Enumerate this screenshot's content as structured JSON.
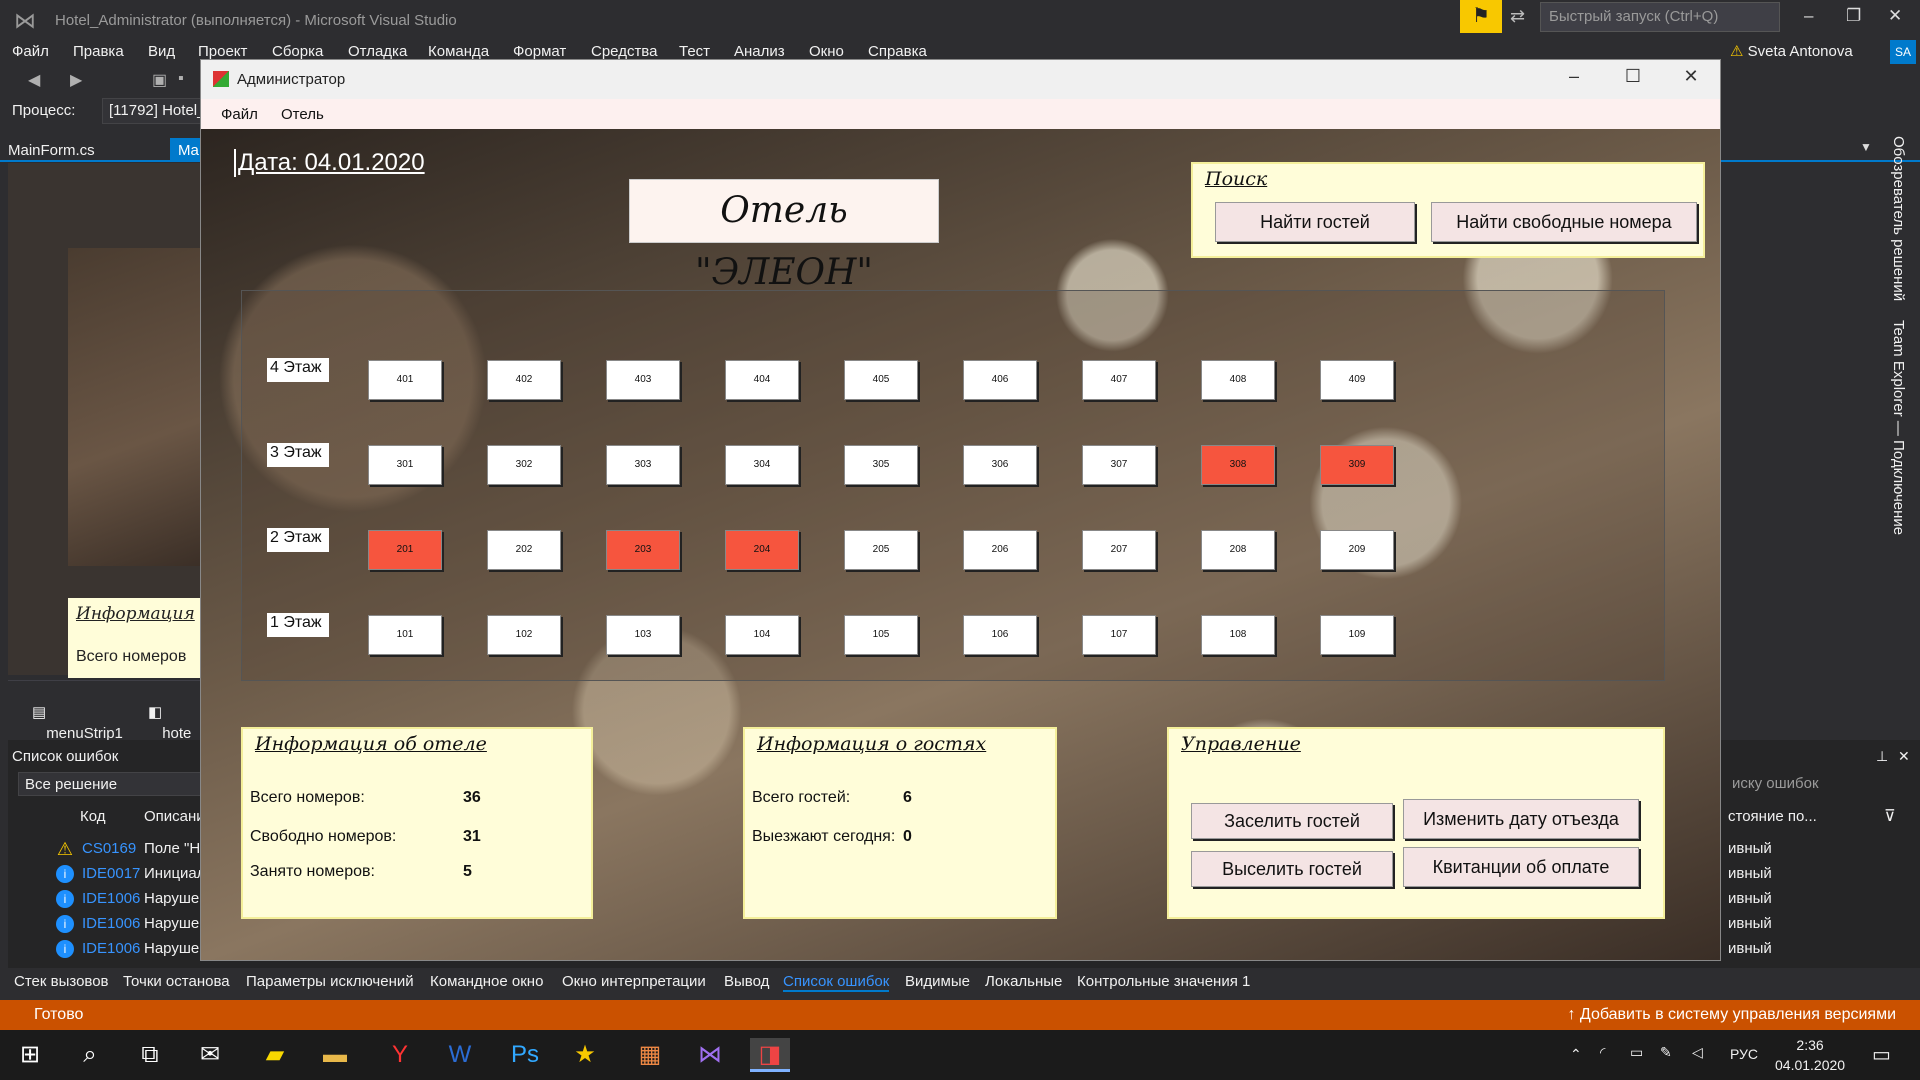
{
  "vs": {
    "title": "Hotel_Administrator (выполняется) - Microsoft Visual Studio",
    "quick_launch": "Быстрый запуск (Ctrl+Q)",
    "menu": [
      "Файл",
      "Правка",
      "Вид",
      "Проект",
      "Сборка",
      "Отладка",
      "Команда",
      "Формат",
      "Средства",
      "Тест",
      "Анализ",
      "Окно",
      "Справка"
    ],
    "user": "Sveta Antonova",
    "user_initials": "SA",
    "process_label": "Процесс:",
    "process_value": "[11792] Hotel_",
    "tab_file": "MainForm.cs",
    "tab_file2": "Ma",
    "designer_info_title": "Информация",
    "designer_info_line": "Всего номеров",
    "tray_items": [
      "menuStrip1",
      "hote"
    ],
    "errors_title": "Список ошибок",
    "errors_scope": "Все решение",
    "errors_col_code": "Код",
    "errors_col_desc": "Описани",
    "errors_search": "иску ошибок",
    "errors_state_col": "стояние по...",
    "errors": [
      {
        "type": "warn",
        "code": "CS0169",
        "desc": "Поле \"Но",
        "state": "ивный"
      },
      {
        "type": "info",
        "code": "IDE0017",
        "desc": "Инициал",
        "state": "ивный"
      },
      {
        "type": "info",
        "code": "IDE1006",
        "desc": "Нарушен",
        "state": "ивный"
      },
      {
        "type": "info",
        "code": "IDE1006",
        "desc": "Нарушен",
        "state": "ивный"
      },
      {
        "type": "info",
        "code": "IDE1006",
        "desc": "Нарушен",
        "state": "ивный"
      }
    ],
    "bottom_tabs": [
      "Стек вызовов",
      "Точки останова",
      "Параметры исключений",
      "Командное окно",
      "Окно интерпретации",
      "Вывод",
      "Список ошибок",
      "Видимые",
      "Локальные",
      "Контрольные значения 1"
    ],
    "bottom_tab_selected": "Список ошибок",
    "status_left": "Готово",
    "status_right": "Добавить в систему управления версиями",
    "side_panels": [
      "Обозреватель решений",
      "Team Explorer — Подключение"
    ]
  },
  "taskbar": {
    "lang": "РУС",
    "time": "2:36",
    "date": "04.01.2020"
  },
  "form": {
    "title": "Администратор",
    "menu": [
      "Файл",
      "Отель"
    ],
    "date_label": "Дата: 04.01.2020",
    "hotel_name": "Отель \"ЭЛЕОН\"",
    "search": {
      "title": "Поиск",
      "find_guests": "Найти гостей",
      "find_rooms": "Найти свободные номера"
    },
    "floors": [
      {
        "label": "4 Этаж",
        "rooms": [
          {
            "n": "401",
            "busy": false
          },
          {
            "n": "402",
            "busy": false
          },
          {
            "n": "403",
            "busy": false
          },
          {
            "n": "404",
            "busy": false
          },
          {
            "n": "405",
            "busy": false
          },
          {
            "n": "406",
            "busy": false
          },
          {
            "n": "407",
            "busy": false
          },
          {
            "n": "408",
            "busy": false
          },
          {
            "n": "409",
            "busy": false
          }
        ]
      },
      {
        "label": "3 Этаж",
        "rooms": [
          {
            "n": "301",
            "busy": false
          },
          {
            "n": "302",
            "busy": false
          },
          {
            "n": "303",
            "busy": false
          },
          {
            "n": "304",
            "busy": false
          },
          {
            "n": "305",
            "busy": false
          },
          {
            "n": "306",
            "busy": false
          },
          {
            "n": "307",
            "busy": false
          },
          {
            "n": "308",
            "busy": true
          },
          {
            "n": "309",
            "busy": true
          }
        ]
      },
      {
        "label": "2 Этаж",
        "rooms": [
          {
            "n": "201",
            "busy": true
          },
          {
            "n": "202",
            "busy": false
          },
          {
            "n": "203",
            "busy": true
          },
          {
            "n": "204",
            "busy": true
          },
          {
            "n": "205",
            "busy": false
          },
          {
            "n": "206",
            "busy": false
          },
          {
            "n": "207",
            "busy": false
          },
          {
            "n": "208",
            "busy": false
          },
          {
            "n": "209",
            "busy": false
          }
        ]
      },
      {
        "label": "1 Этаж",
        "rooms": [
          {
            "n": "101",
            "busy": false
          },
          {
            "n": "102",
            "busy": false
          },
          {
            "n": "103",
            "busy": false
          },
          {
            "n": "104",
            "busy": false
          },
          {
            "n": "105",
            "busy": false
          },
          {
            "n": "106",
            "busy": false
          },
          {
            "n": "107",
            "busy": false
          },
          {
            "n": "108",
            "busy": false
          },
          {
            "n": "109",
            "busy": false
          }
        ]
      }
    ],
    "hotel_info": {
      "title": "Информация об отеле",
      "total_label": "Всего номеров:",
      "total": "36",
      "free_label": "Свободно номеров:",
      "free": "31",
      "busy_label": "Занято номеров:",
      "busy": "5"
    },
    "guest_info": {
      "title": "Информация о гостях",
      "total_label": "Всего гостей:",
      "total": "6",
      "leaving_label": "Выезжают сегодня:",
      "leaving": "0"
    },
    "control": {
      "title": "Управление",
      "checkin": "Заселить гостей",
      "change_date": "Изменить дату отъезда",
      "checkout": "Выселить гостей",
      "receipts": "Квитанции об оплате"
    },
    "colors": {
      "busy": "#f6553e",
      "free": "#ffffff",
      "panel": "#fffdd9"
    }
  }
}
